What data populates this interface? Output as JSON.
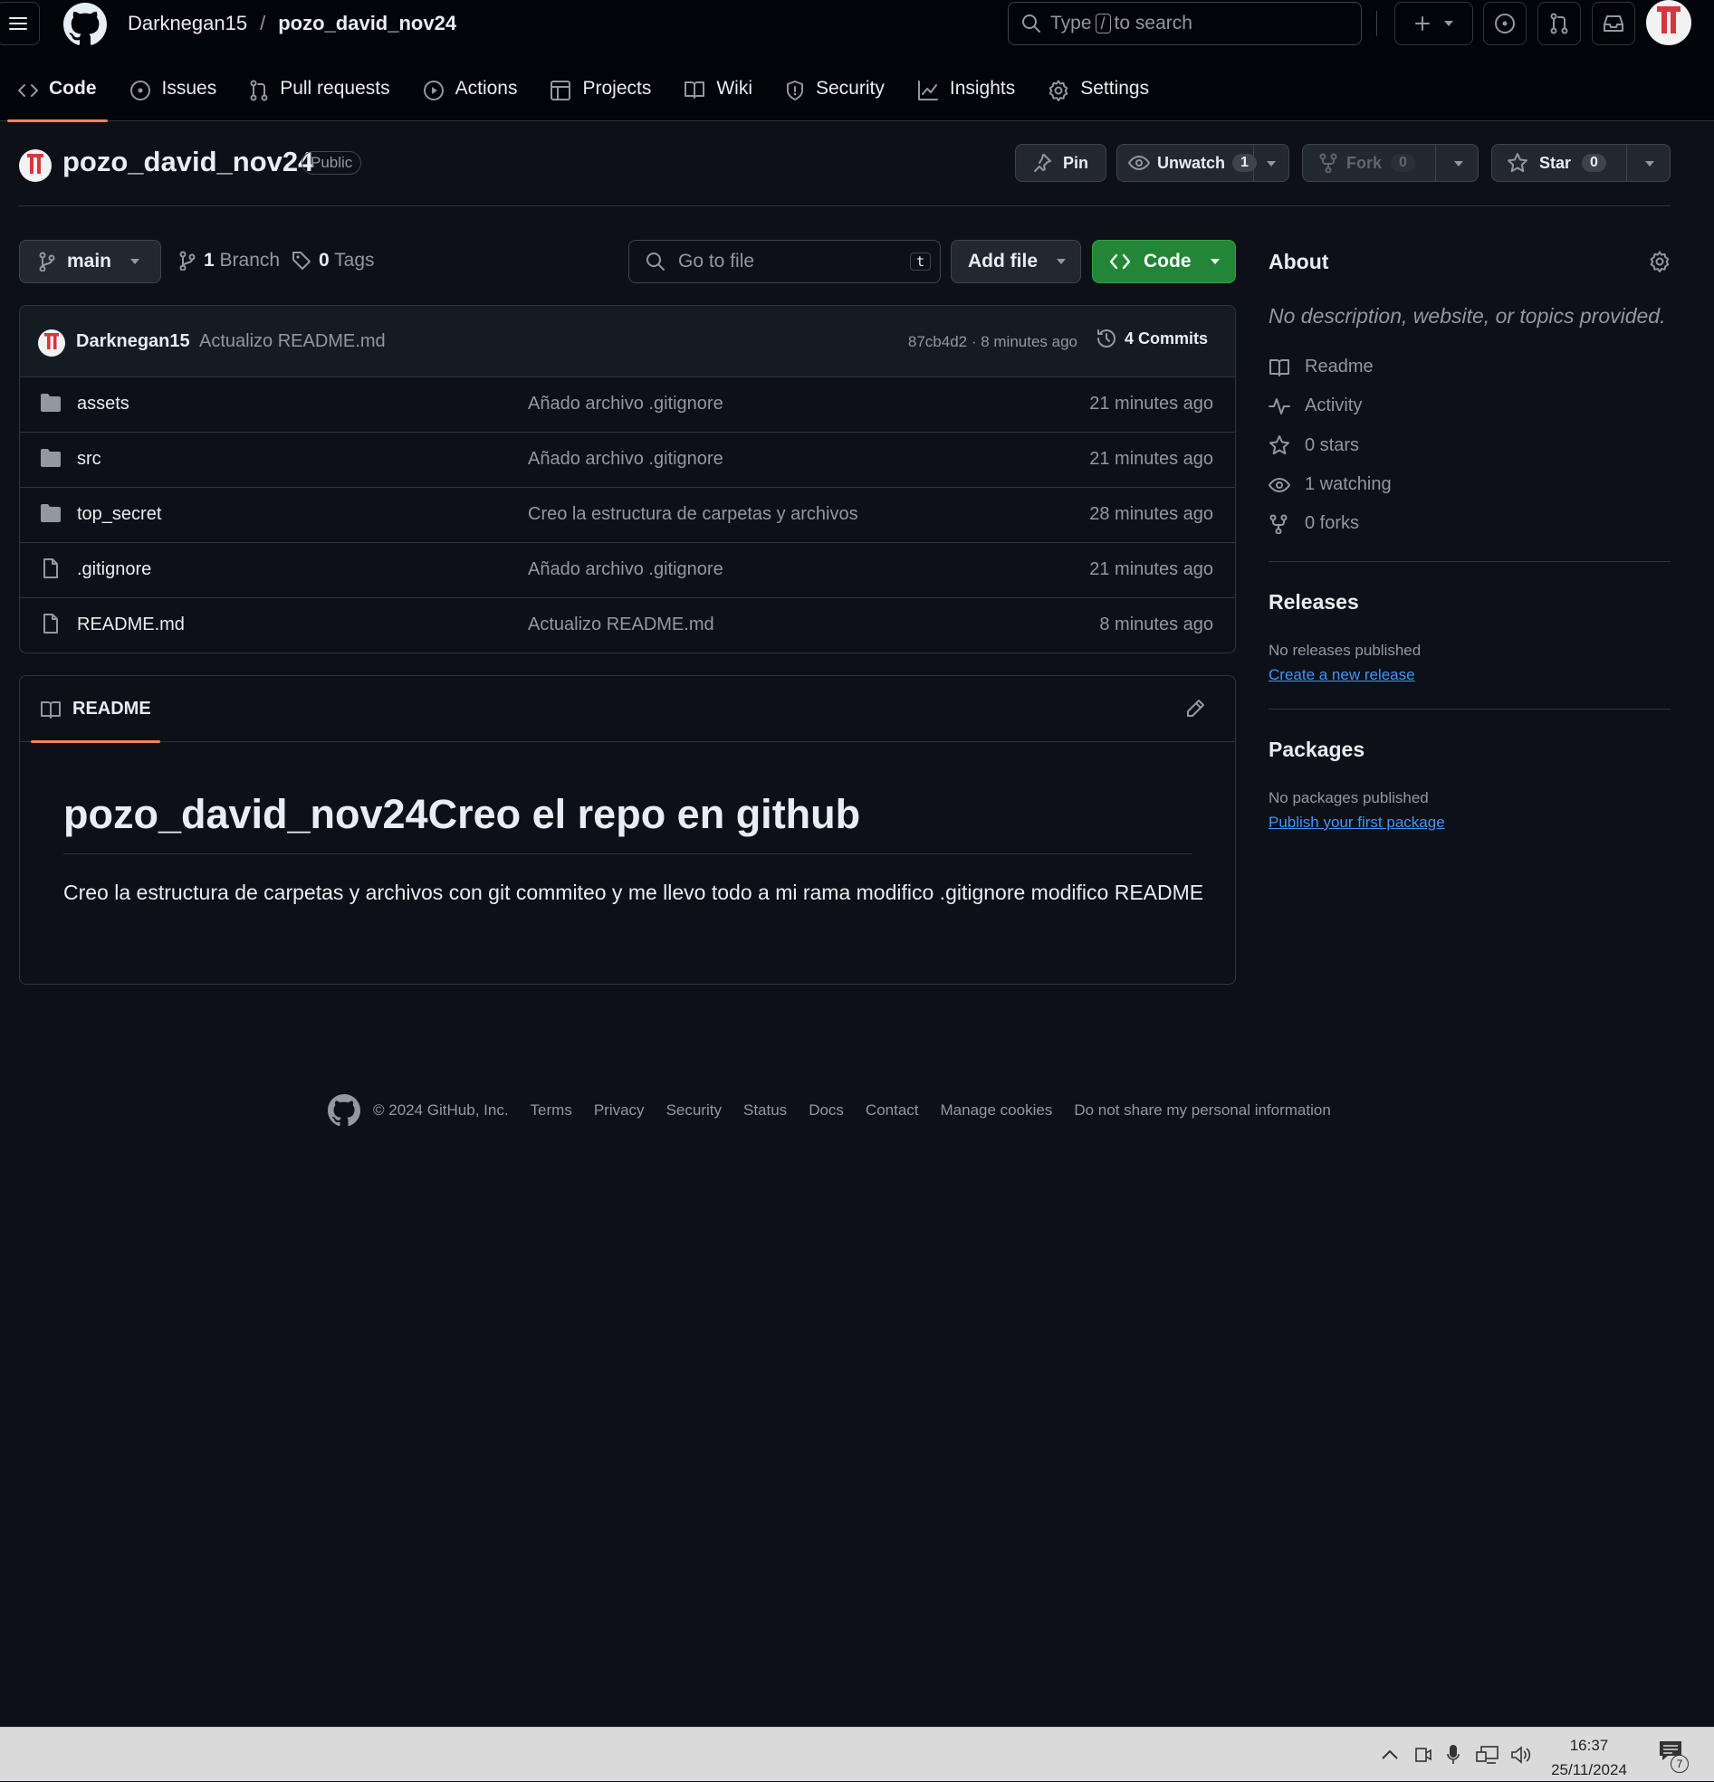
{
  "header": {
    "owner": "Darknegan15",
    "separator": "/",
    "repo": "pozo_david_nov24",
    "search_prefix": "Type",
    "search_key": "/",
    "search_suffix": "to search"
  },
  "tabs": [
    {
      "label": "Code",
      "icon": "code-icon",
      "active": true
    },
    {
      "label": "Issues",
      "icon": "issue-icon"
    },
    {
      "label": "Pull requests",
      "icon": "pull-request-icon"
    },
    {
      "label": "Actions",
      "icon": "play-icon"
    },
    {
      "label": "Projects",
      "icon": "table-icon"
    },
    {
      "label": "Wiki",
      "icon": "book-icon"
    },
    {
      "label": "Security",
      "icon": "shield-icon"
    },
    {
      "label": "Insights",
      "icon": "graph-icon"
    },
    {
      "label": "Settings",
      "icon": "gear-icon"
    }
  ],
  "repo_header": {
    "title": "pozo_david_nov24",
    "visibility": "Public",
    "pin_label": "Pin",
    "unwatch_label": "Unwatch",
    "watch_count": "1",
    "fork_label": "Fork",
    "fork_count": "0",
    "star_label": "Star",
    "star_count": "0"
  },
  "toolbar": {
    "branch": "main",
    "branch_count": "1",
    "branch_label": "Branch",
    "tag_count": "0",
    "tag_label": "Tags",
    "goto_placeholder": "Go to file",
    "goto_key": "t",
    "add_file_label": "Add file",
    "code_label": "Code"
  },
  "latest_commit": {
    "author": "Darknegan15",
    "message": "Actualizo README.md",
    "meta": "87cb4d2 · 8 minutes ago",
    "commits_label": "4 Commits"
  },
  "files": [
    {
      "name": "assets",
      "type": "folder",
      "message": "Añado archivo .gitignore",
      "time": "21 minutes ago"
    },
    {
      "name": "src",
      "type": "folder",
      "message": "Añado archivo .gitignore",
      "time": "21 minutes ago"
    },
    {
      "name": "top_secret",
      "type": "folder",
      "message": "Creo la estructura de carpetas y archivos",
      "time": "28 minutes ago"
    },
    {
      "name": ".gitignore",
      "type": "file",
      "message": "Añado archivo .gitignore",
      "time": "21 minutes ago"
    },
    {
      "name": "README.md",
      "type": "file",
      "message": "Actualizo README.md",
      "time": "8 minutes ago"
    }
  ],
  "readme": {
    "tab_label": "README",
    "heading": "pozo_david_nov24Creo el repo en github",
    "body": "Creo la estructura de carpetas y archivos con git commiteo y me llevo todo a mi rama modifico .gitignore modifico README"
  },
  "sidebar": {
    "about_title": "About",
    "about_desc": "No description, website, or topics provided.",
    "items": [
      {
        "label": "Readme",
        "icon": "book-icon"
      },
      {
        "label": "Activity",
        "icon": "pulse-icon"
      },
      {
        "label": "0 stars",
        "icon": "star-icon"
      },
      {
        "label": "1 watching",
        "icon": "eye-icon"
      },
      {
        "label": "0 forks",
        "icon": "fork-icon"
      }
    ],
    "releases_title": "Releases",
    "releases_text": "No releases published",
    "releases_link": "Create a new release",
    "packages_title": "Packages",
    "packages_text": "No packages published",
    "packages_link": "Publish your first package"
  },
  "footer": {
    "copyright": "© 2024 GitHub, Inc.",
    "links": [
      "Terms",
      "Privacy",
      "Security",
      "Status",
      "Docs",
      "Contact",
      "Manage cookies",
      "Do not share my personal information"
    ]
  },
  "taskbar": {
    "time": "16:37",
    "date": "25/11/2024",
    "notifications": "7"
  },
  "colors": {
    "background": "#0d1117",
    "header": "#010409",
    "accent_tab": "#f78166",
    "code_button": "#238636",
    "link": "#4493f8"
  }
}
